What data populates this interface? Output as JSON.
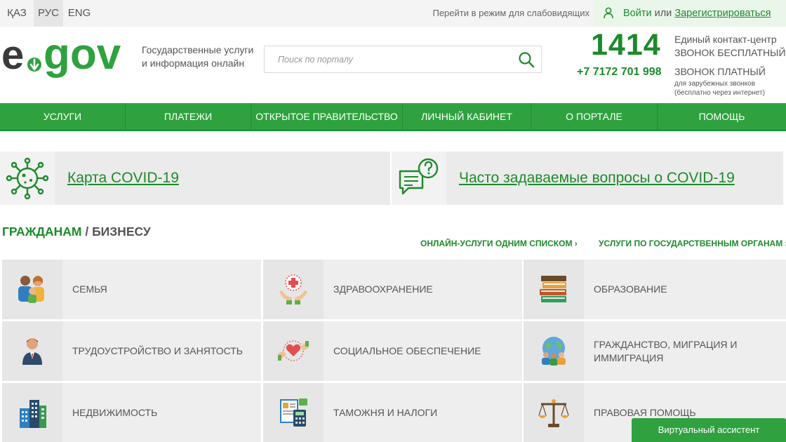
{
  "topbar": {
    "languages": [
      {
        "label": "ҚАЗ",
        "active": false
      },
      {
        "label": "РУС",
        "active": true
      },
      {
        "label": "ENG",
        "active": false
      }
    ],
    "low_vision": "Перейти в режим для слабовидящих",
    "login": "Войти",
    "or": "или",
    "register": "Зарегистрироваться"
  },
  "header": {
    "slogan_line1": "Государственные услуги",
    "slogan_line2": "и информация онлайн",
    "search_placeholder": "Поиск по порталу",
    "hotline": "1414",
    "contact_center": "Единый контакт-центр",
    "free_call": "ЗВОНОК БЕСПЛАТНЫЙ",
    "phone": "+7 7172 701 998",
    "paid_call": "ЗВОНОК ПЛАТНЫЙ",
    "foreign_calls": "для зарубежных звонков",
    "internet_free": "(бесплатно через интернет)"
  },
  "nav": [
    {
      "label": "УСЛУГИ",
      "width": 179
    },
    {
      "label": "ПЛАТЕЖИ",
      "width": 179
    },
    {
      "label": "ОТКРЫТОЕ ПРАВИТЕЛЬСТВО",
      "width": 216
    },
    {
      "label": "ЛИЧНЫЙ КАБИНЕТ",
      "width": 183
    },
    {
      "label": "О ПОРТАЛЕ",
      "width": 180
    },
    {
      "label": "ПОМОЩЬ",
      "width": 183
    }
  ],
  "banners": {
    "covid_map": "Карта COVID-19",
    "covid_faq": "Часто задаваемые вопросы о COVID-19"
  },
  "section": {
    "citizens": "ГРАЖДАНАМ",
    "sep": " / ",
    "business": "БИЗНЕСУ",
    "online_list": "ОНЛАЙН-УСЛУГИ ОДНИМ СПИСКОМ ›",
    "by_agency": "УСЛУГИ ПО ГОСУДАРСТВЕННЫМ ОРГАНАМ ›"
  },
  "categories": [
    {
      "label": "СЕМЬЯ",
      "icon": "family-icon"
    },
    {
      "label": "ЗДРАВООХРАНЕНИЕ",
      "icon": "healthcare-icon"
    },
    {
      "label": "ОБРАЗОВАНИЕ",
      "icon": "books-icon"
    },
    {
      "label": "ТРУДОУСТРОЙСТВО И ЗАНЯТОСТЬ",
      "icon": "worker-icon"
    },
    {
      "label": "СОЦИАЛЬНОЕ ОБЕСПЕЧЕНИЕ",
      "icon": "social-care-icon"
    },
    {
      "label": "ГРАЖДАНСТВО, МИГРАЦИЯ И ИММИГРАЦИЯ",
      "icon": "globe-people-icon"
    },
    {
      "label": "НЕДВИЖИМОСТЬ",
      "icon": "buildings-icon"
    },
    {
      "label": "ТАМОЖНЯ И НАЛОГИ",
      "icon": "tax-calculator-icon"
    },
    {
      "label": "ПРАВОВАЯ ПОМОЩЬ",
      "icon": "scales-icon"
    }
  ],
  "assistant": "Виртуальный ассистент",
  "colors": {
    "brand_green": "#1d8a2c",
    "nav_green": "#2fa23f"
  }
}
